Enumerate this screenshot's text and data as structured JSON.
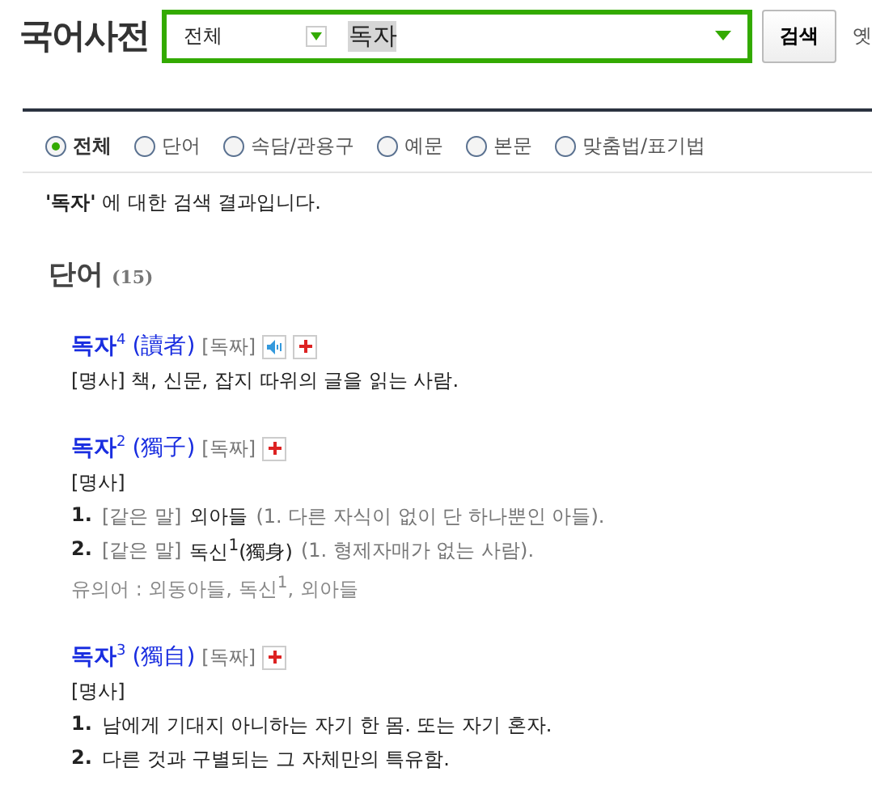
{
  "header": {
    "logo": "국어사전",
    "scope": "전체",
    "query": "독자",
    "search_button": "검색",
    "side_link": "옛"
  },
  "filters": [
    {
      "label": "전체",
      "selected": true
    },
    {
      "label": "단어",
      "selected": false
    },
    {
      "label": "속담/관용구",
      "selected": false
    },
    {
      "label": "예문",
      "selected": false
    },
    {
      "label": "본문",
      "selected": false
    },
    {
      "label": "맞춤법/표기법",
      "selected": false
    }
  ],
  "result_note": "**'독자'** 에 대한 검색 결과입니다.",
  "section": {
    "title": "단어",
    "count": "(15)"
  },
  "entries": [
    {
      "headword": "독자",
      "homonym": "4",
      "hanja": "(讀者)",
      "pronunciation": "[독짜]",
      "has_sound": true,
      "pos": "[명사]",
      "definition": "책, 신문, 잡지 따위의 글을 읽는 사람."
    },
    {
      "headword": "독자",
      "homonym": "2",
      "hanja": "(獨子)",
      "pronunciation": "[독짜]",
      "has_sound": false,
      "pos": "[명사]",
      "senses": [
        {
          "number": "1.",
          "tag": "[같은 말]",
          "word": "외아들",
          "rest": "(1. 다른 자식이 없이 단 하나뿐인 아들)."
        },
        {
          "number": "2.",
          "tag": "[같은 말]",
          "word": "독신$^{1}$(獨身)",
          "rest": "(1. 형제자매가 없는 사람)."
        }
      ],
      "synonyms": "유의어 : 외동아들, 독신$^{1}$, 외아들"
    },
    {
      "headword": "독자",
      "homonym": "3",
      "hanja": "(獨自)",
      "pronunciation": "[독짜]",
      "has_sound": false,
      "pos": "[명사]",
      "senses": [
        {
          "number": "1.",
          "text": "남에게 기대지 아니하는 자기 한 몸. 또는 자기 혼자."
        },
        {
          "number": "2.",
          "text": "다른 것과 구별되는 그 자체만의 특유함."
        }
      ]
    }
  ]
}
